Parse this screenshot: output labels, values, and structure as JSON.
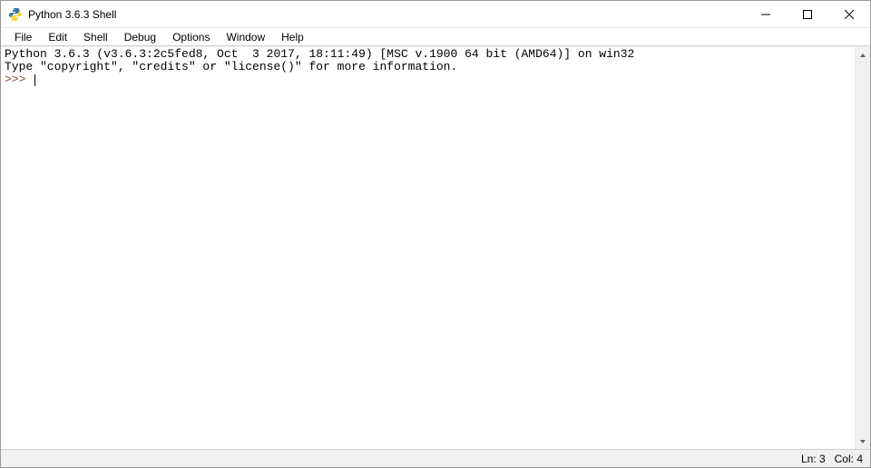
{
  "window": {
    "title": "Python 3.6.3 Shell"
  },
  "menu": {
    "items": [
      "File",
      "Edit",
      "Shell",
      "Debug",
      "Options",
      "Window",
      "Help"
    ]
  },
  "shell": {
    "banner_line1": "Python 3.6.3 (v3.6.3:2c5fed8, Oct  3 2017, 18:11:49) [MSC v.1900 64 bit (AMD64)] on win32",
    "banner_line2": "Type \"copyright\", \"credits\" or \"license()\" for more information.",
    "prompt": ">>> "
  },
  "status": {
    "line": "Ln: 3",
    "col": "Col: 4"
  }
}
